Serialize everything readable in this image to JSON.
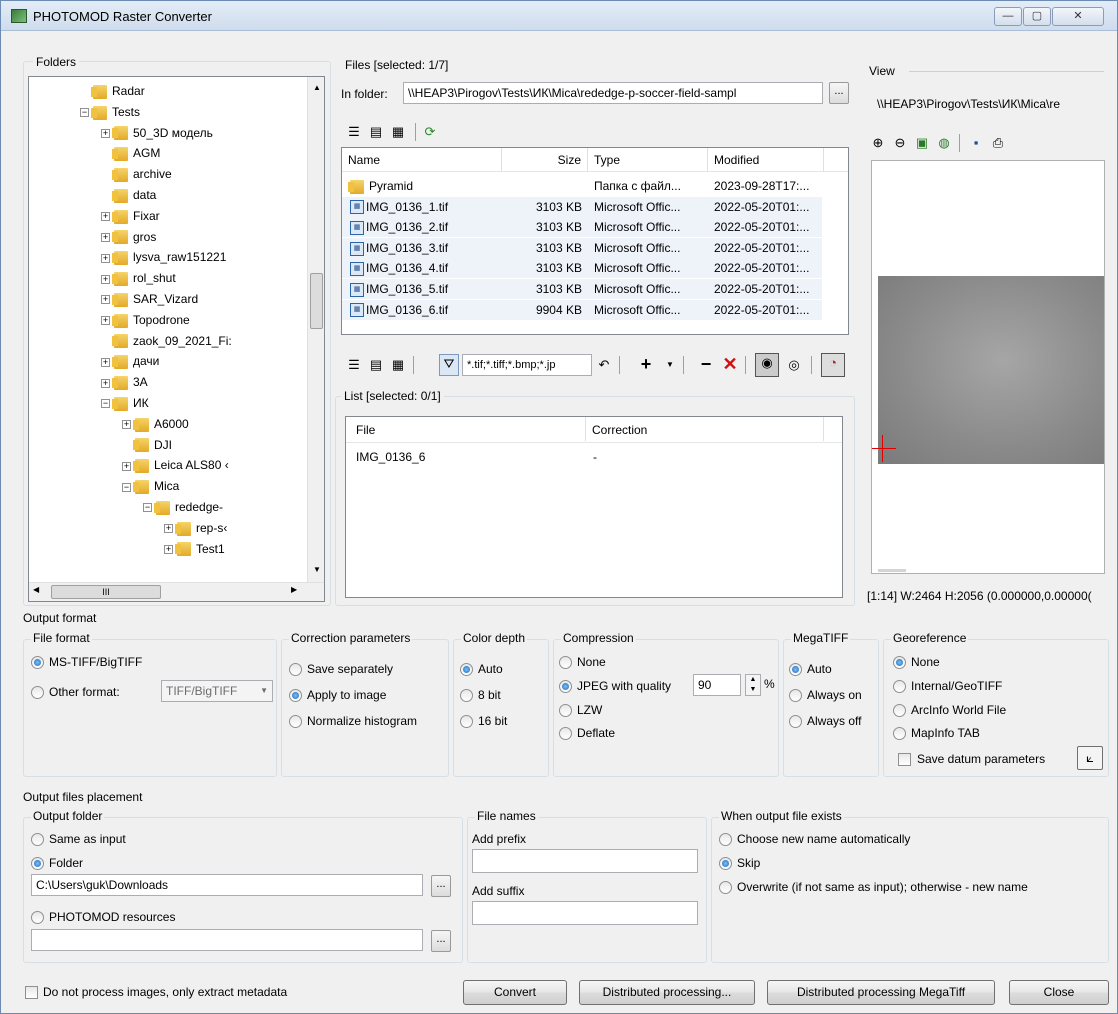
{
  "window": {
    "title": "PHOTOMOD Raster Converter",
    "min": "—",
    "max": "▢",
    "close": "✕"
  },
  "folders": {
    "title": "Folders",
    "items": [
      {
        "label": "Radar",
        "exp": ""
      },
      {
        "label": "Tests",
        "exp": "−"
      },
      {
        "label": "50_3D модель",
        "exp": "+"
      },
      {
        "label": "AGM",
        "exp": ""
      },
      {
        "label": "archive",
        "exp": ""
      },
      {
        "label": "data",
        "exp": ""
      },
      {
        "label": "Fixar",
        "exp": "+"
      },
      {
        "label": "gros",
        "exp": "+"
      },
      {
        "label": "lysva_raw151221",
        "exp": "+"
      },
      {
        "label": "rol_shut",
        "exp": "+"
      },
      {
        "label": "SAR_Vizard",
        "exp": "+"
      },
      {
        "label": "Topodrone",
        "exp": "+"
      },
      {
        "label": "zaok_09_2021_Fi:",
        "exp": ""
      },
      {
        "label": "дачи",
        "exp": "+"
      },
      {
        "label": "3A",
        "exp": "+"
      },
      {
        "label": "ИК",
        "exp": "−"
      },
      {
        "label": "A6000",
        "exp": "+"
      },
      {
        "label": "DJI",
        "exp": ""
      },
      {
        "label": "Leica ALS80 ‹",
        "exp": "+"
      },
      {
        "label": "Mica",
        "exp": "−"
      },
      {
        "label": "rededge-",
        "exp": "−"
      },
      {
        "label": "rep-s‹",
        "exp": "+"
      },
      {
        "label": "Test1",
        "exp": "+"
      }
    ],
    "hscroll_mid": "III"
  },
  "files": {
    "title": "Files [selected: 1/7]",
    "in_folder_label": "In folder:",
    "path": "\\\\HEAP3\\Pirogov\\Tests\\ИК\\Mica\\rededge-p-soccer-field-sampl",
    "browse": "...",
    "columns": [
      "Name",
      "Size",
      "Type",
      "Modified"
    ],
    "rows": [
      {
        "name": "Pyramid",
        "size": "",
        "type": "Папка с файл...",
        "modified": "2023-09-28T17:...",
        "folder": true
      },
      {
        "name": "IMG_0136_1.tif",
        "size": "3103 KB",
        "type": "Microsoft Offic...",
        "modified": "2022-05-20T01:...",
        "folder": false
      },
      {
        "name": "IMG_0136_2.tif",
        "size": "3103 KB",
        "type": "Microsoft Offic...",
        "modified": "2022-05-20T01:...",
        "folder": false
      },
      {
        "name": "IMG_0136_3.tif",
        "size": "3103 KB",
        "type": "Microsoft Offic...",
        "modified": "2022-05-20T01:...",
        "folder": false
      },
      {
        "name": "IMG_0136_4.tif",
        "size": "3103 KB",
        "type": "Microsoft Offic...",
        "modified": "2022-05-20T01:...",
        "folder": false
      },
      {
        "name": "IMG_0136_5.tif",
        "size": "3103 KB",
        "type": "Microsoft Offic...",
        "modified": "2022-05-20T01:...",
        "folder": false
      },
      {
        "name": "IMG_0136_6.tif",
        "size": "9904 KB",
        "type": "Microsoft Offic...",
        "modified": "2022-05-20T01:...",
        "folder": false
      }
    ]
  },
  "filter": {
    "mask": "*.tif;*.tiff;*.bmp;*.jp"
  },
  "list": {
    "title": "List [selected: 0/1]",
    "columns": [
      "File",
      "Correction"
    ],
    "rows": [
      {
        "file": "IMG_0136_6",
        "correction": "-"
      }
    ]
  },
  "view": {
    "title": "View",
    "path": "\\\\HEAP3\\Pirogov\\Tests\\ИК\\Mica\\re",
    "status": "[1:14] W:2464 H:2056 (0.000000,0.00000("
  },
  "output_format": {
    "title": "Output format",
    "file_format": {
      "title": "File format",
      "opt1": "MS-TIFF/BigTIFF",
      "opt2": "Other format:",
      "select": "TIFF/BigTIFF"
    },
    "correction": {
      "title": "Correction parameters",
      "opt1": "Save separately",
      "opt2": "Apply to image",
      "opt3": "Normalize histogram"
    },
    "color_depth": {
      "title": "Color depth",
      "opt1": "Auto",
      "opt2": "8 bit",
      "opt3": "16 bit"
    },
    "compression": {
      "title": "Compression",
      "opt1": "None",
      "opt2": "JPEG with quality",
      "quality": "90",
      "pct": "%",
      "opt3": "LZW",
      "opt4": "Deflate"
    },
    "megatiff": {
      "title": "MegaTIFF",
      "opt1": "Auto",
      "opt2": "Always on",
      "opt3": "Always off"
    },
    "georef": {
      "title": "Georeference",
      "opt1": "None",
      "opt2": "Internal/GeoTIFF",
      "opt3": "ArcInfo World File",
      "opt4": "MapInfo TAB",
      "datum": "Save datum parameters"
    }
  },
  "placement": {
    "title": "Output files placement",
    "folder": {
      "title": "Output folder",
      "opt1": "Same as input",
      "opt2": "Folder",
      "path": "C:\\Users\\guk\\Downloads",
      "opt3": "PHOTOMOD resources",
      "path2": "",
      "browse": "..."
    },
    "names": {
      "title": "File names",
      "prefix_label": "Add prefix",
      "prefix": "",
      "suffix_label": "Add suffix",
      "suffix": ""
    },
    "exists": {
      "title": "When output file exists",
      "opt1": "Choose new name automatically",
      "opt2": "Skip",
      "opt3": "Overwrite (if not same as input); otherwise - new name"
    }
  },
  "footer": {
    "metadata_only": "Do not process images, only extract metadata",
    "convert": "Convert",
    "distributed": "Distributed processing...",
    "distributed_mega": "Distributed processing MegaTiff",
    "close": "Close"
  }
}
